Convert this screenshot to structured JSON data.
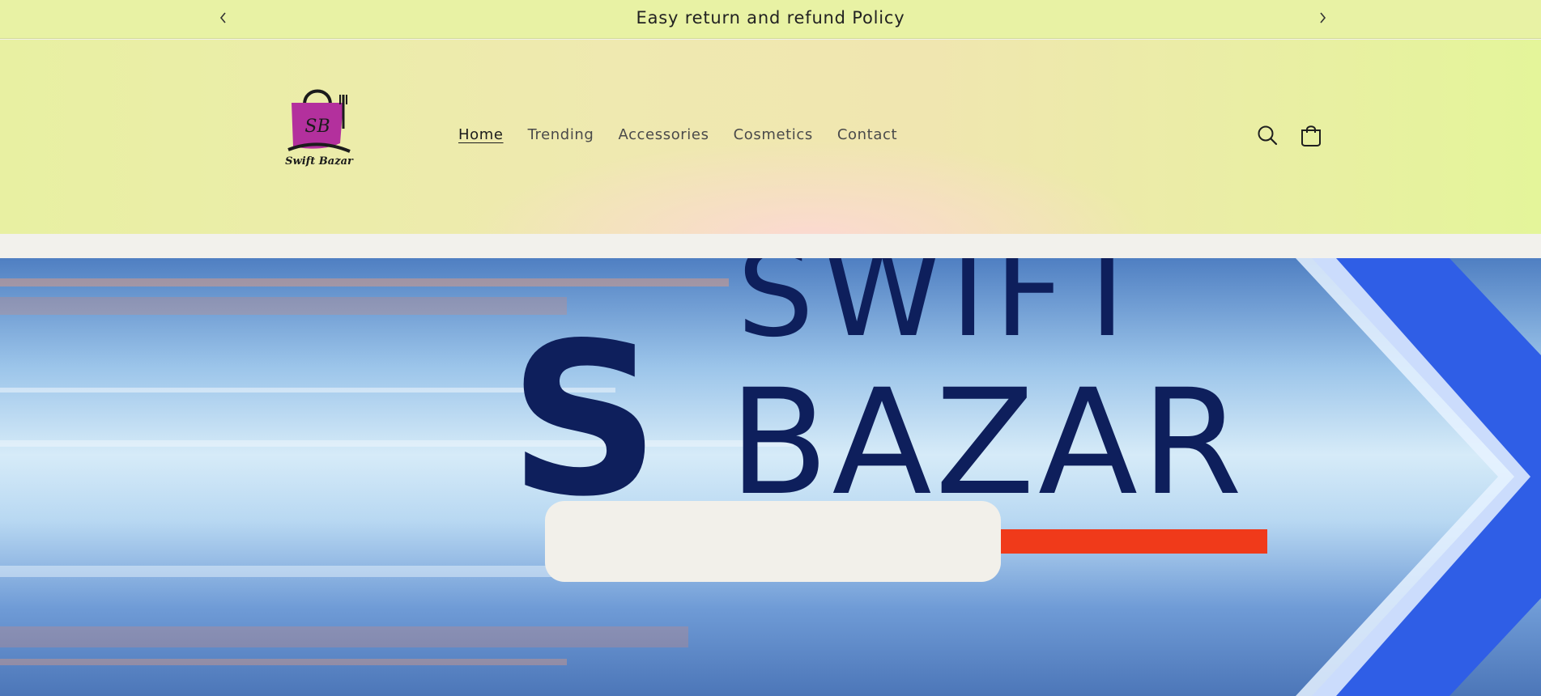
{
  "announcement": {
    "message": "Easy return and refund Policy",
    "prev_icon": "chevron-left-icon",
    "next_icon": "chevron-right-icon"
  },
  "header": {
    "logo": {
      "monogram": "SB",
      "wordmark": "Swift Bazar"
    },
    "nav": [
      {
        "label": "Home",
        "active": true
      },
      {
        "label": "Trending",
        "active": false
      },
      {
        "label": "Accessories",
        "active": false
      },
      {
        "label": "Cosmetics",
        "active": false
      },
      {
        "label": "Contact",
        "active": false
      }
    ],
    "icons": {
      "search": "search-icon",
      "cart": "cart-icon"
    }
  },
  "hero": {
    "line1": "SWIFT",
    "letter": "S",
    "line2": "BAZAR"
  },
  "colors": {
    "announce_bg": "#e8f2a4",
    "brand_purple": "#b3309d",
    "hero_navy": "#0e1f5c",
    "accent_orange": "#f03a1a",
    "accent_blue": "#2f5ee6"
  }
}
